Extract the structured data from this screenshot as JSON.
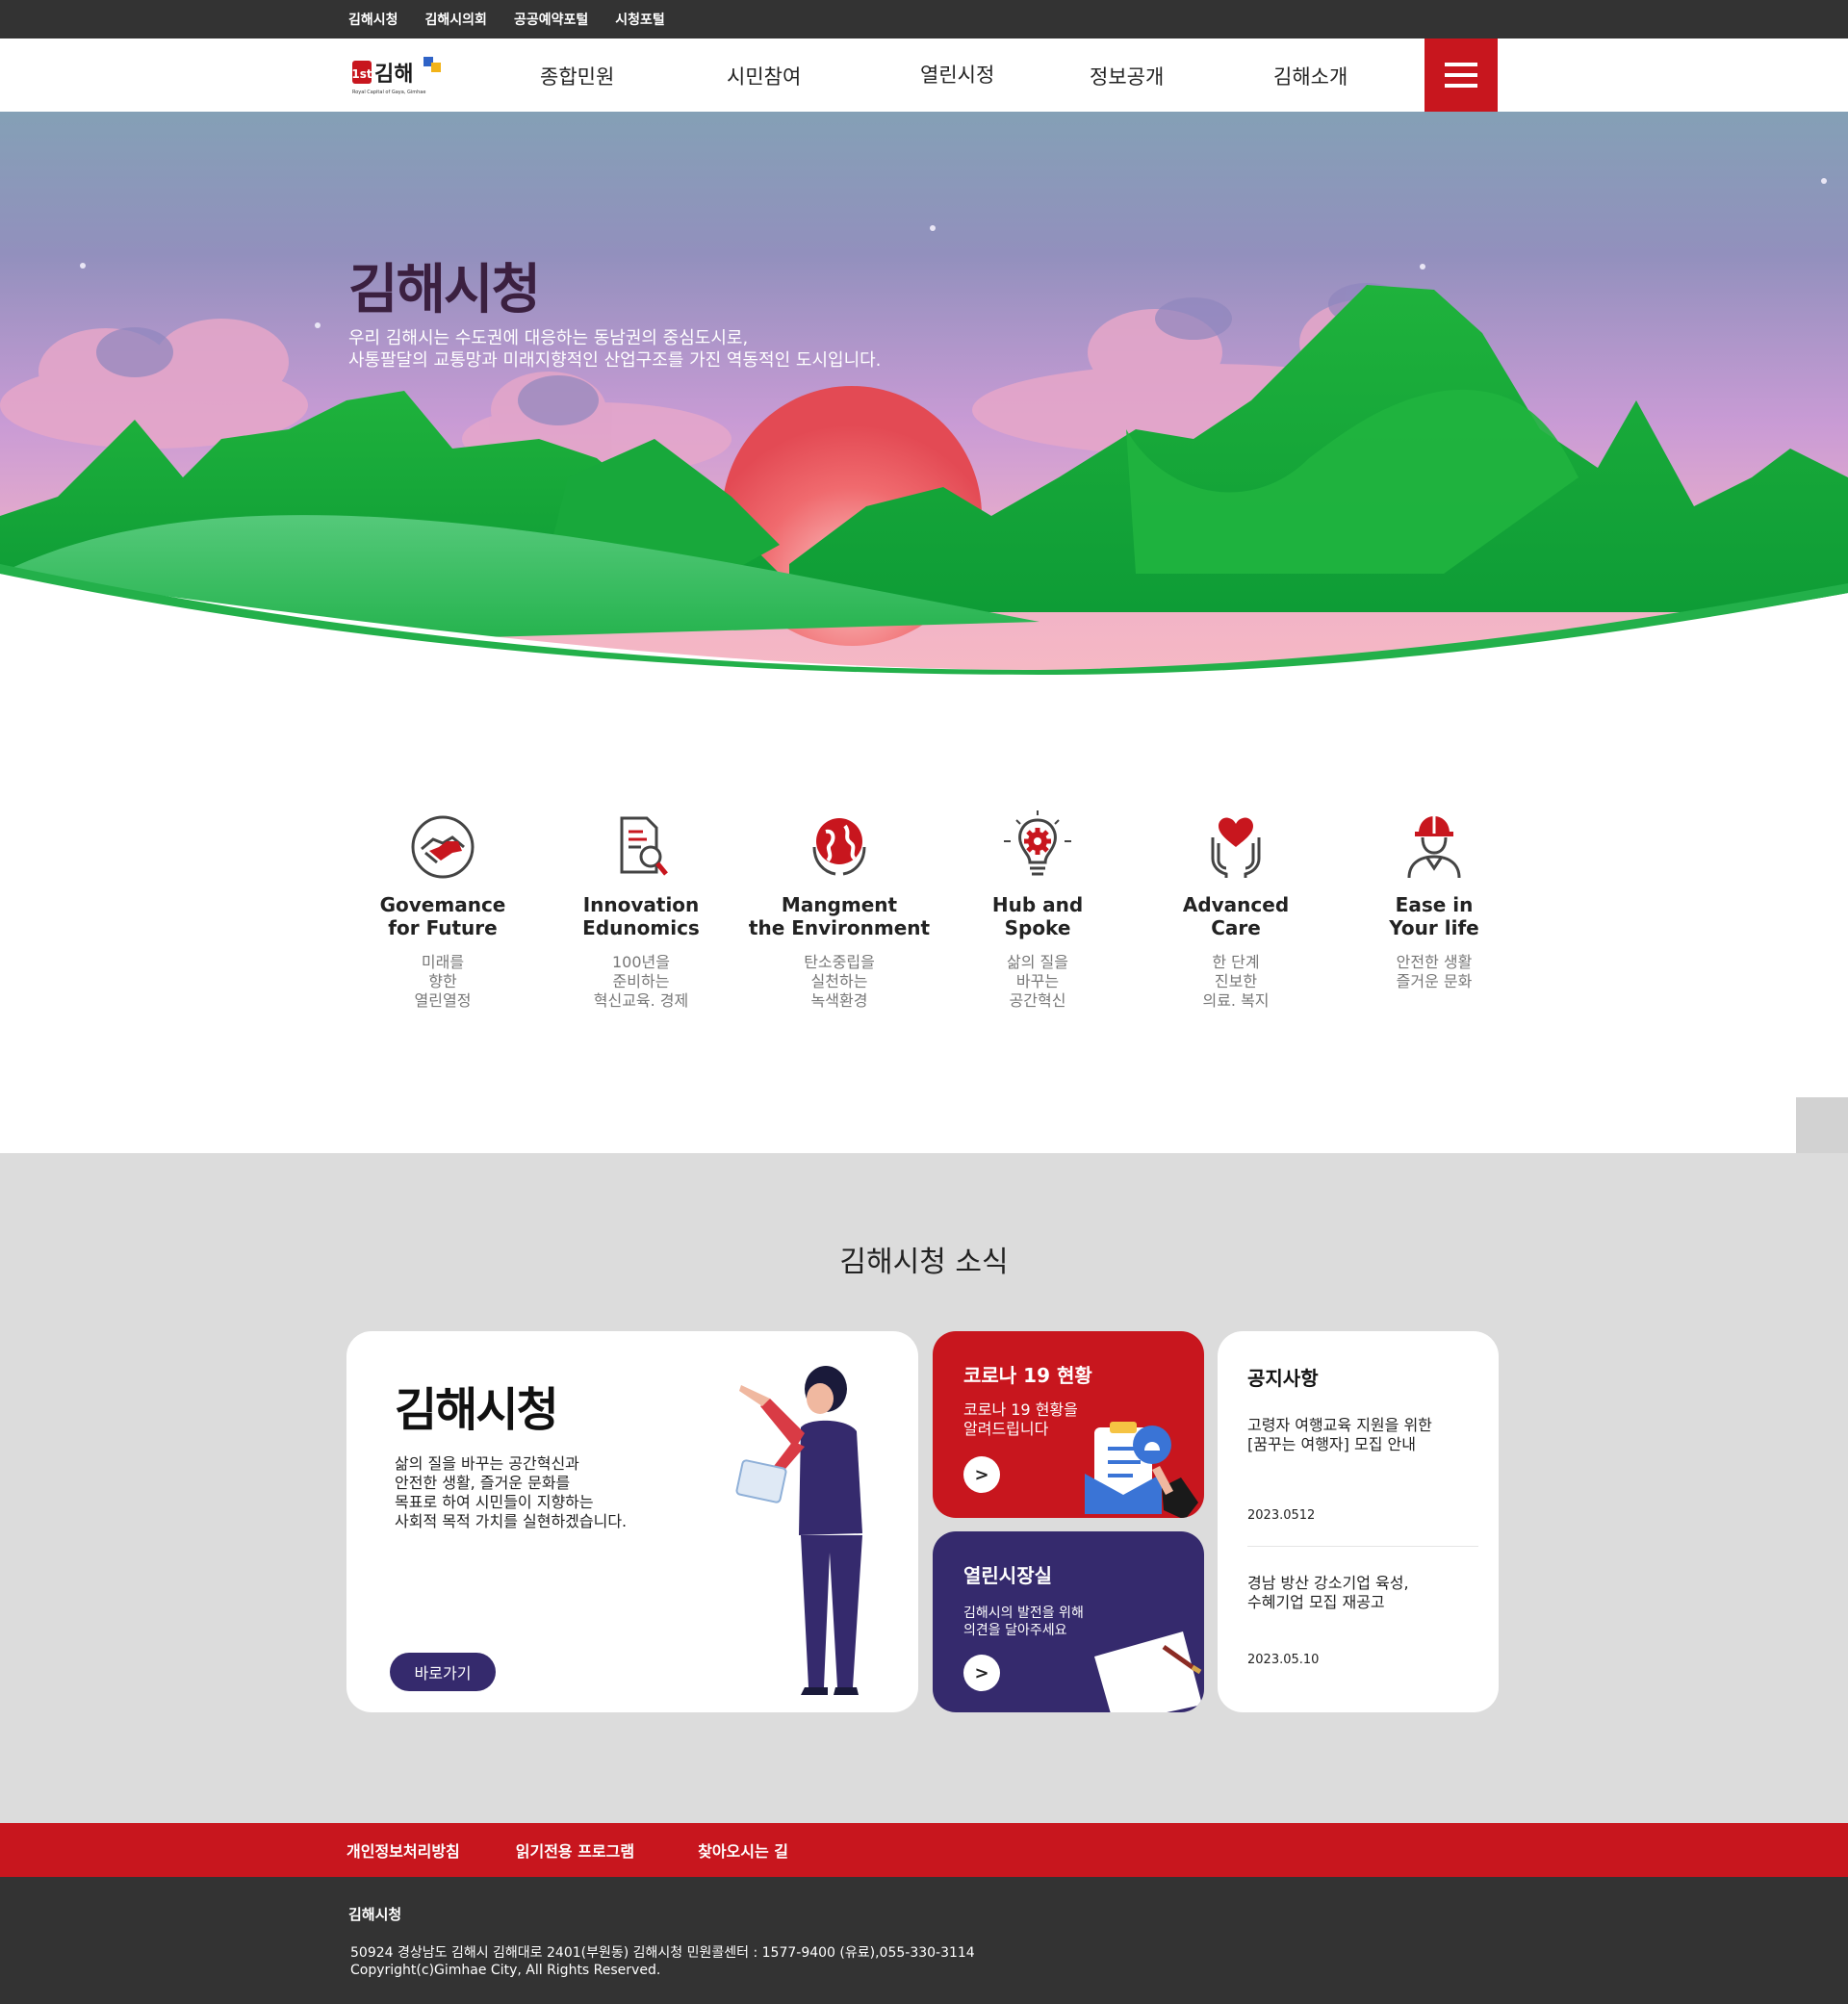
{
  "topbar": {
    "links": [
      "김해시청",
      "김해시의회",
      "공공예약포털",
      "시청포털"
    ]
  },
  "header": {
    "logo_text": "김해",
    "logo_sub": "Royal Capital of Gaya, Gimhae",
    "nav": [
      "종합민원",
      "시민참여",
      "열린시정",
      "정보공개",
      "김해소개"
    ]
  },
  "hero": {
    "title": "김해시청",
    "desc_line1": "우리 김해시는 수도권에 대응하는 동남권의 중심도시로,",
    "desc_line2": "사통팔달의 교통망과 미래지향적인 산업구조를 가진 역동적인 도시입니다."
  },
  "values": [
    {
      "icon": "handshake-icon",
      "title": "Govemance\nfor Future",
      "desc": "미래를\n향한\n열린열정"
    },
    {
      "icon": "document-search-icon",
      "title": "Innovation\nEdunomics",
      "desc": "100년을\n준비하는\n혁신교육. 경제"
    },
    {
      "icon": "globe-hands-icon",
      "title": "Mangment\nthe Environment",
      "desc": "탄소중립을\n실천하는\n녹색환경"
    },
    {
      "icon": "lightbulb-gear-icon",
      "title": "Hub and\nSpoke",
      "desc": "삶의 질을\n바꾸는\n공간혁신"
    },
    {
      "icon": "heart-hands-icon",
      "title": "Advanced\nCare",
      "desc": "한 단계\n진보한\n의료. 복지"
    },
    {
      "icon": "worker-helmet-icon",
      "title": "Ease in\nYour life",
      "desc": "안전한 생활\n즐거운 문화"
    }
  ],
  "news": {
    "section_title": "김해시청 소식",
    "main_card": {
      "title": "김해시청",
      "desc": "삶의 질을 바꾸는 공간혁신과\n안전한 생활, 즐거운 문화를\n목표로 하여 시민들이 지향하는\n사회적 목적 가치를 실현하겠습니다.",
      "button": "바로가기"
    },
    "covid_card": {
      "title": "코로나 19 현황",
      "desc": "코로나 19 현황을\n알려드립니다",
      "arrow": ">"
    },
    "open_card": {
      "title": "열린시장실",
      "desc": "김해시의 발전을 위해\n의견을 달아주세요",
      "arrow": ">"
    },
    "notice": {
      "title": "공지사항",
      "items": [
        {
          "title": "고령자 여행교육 지원을 위한\n[꿈꾸는 여행자] 모집 안내",
          "date": "2023.0512"
        },
        {
          "title": "경남 방산 강소기업 육성,\n수혜기업 모집 재공고",
          "date": "2023.05.10"
        }
      ]
    }
  },
  "footer": {
    "links": [
      "개인정보처리방침",
      "읽기전용 프로그램",
      "찾아오시는 길"
    ],
    "name": "김해시청",
    "address": "50924 경상남도 김해시 김해대로 2401(부원동) 김해시청 민원콜센터 : 1577-9400 (유료),055-330-3114",
    "copyright": "Copyright(c)Gimhae City, All Rights Reserved."
  },
  "colors": {
    "brand_red": "#c8161e",
    "brand_purple": "#352a6d",
    "dark_gray": "#333333",
    "mountain_green": "#1db83f"
  }
}
